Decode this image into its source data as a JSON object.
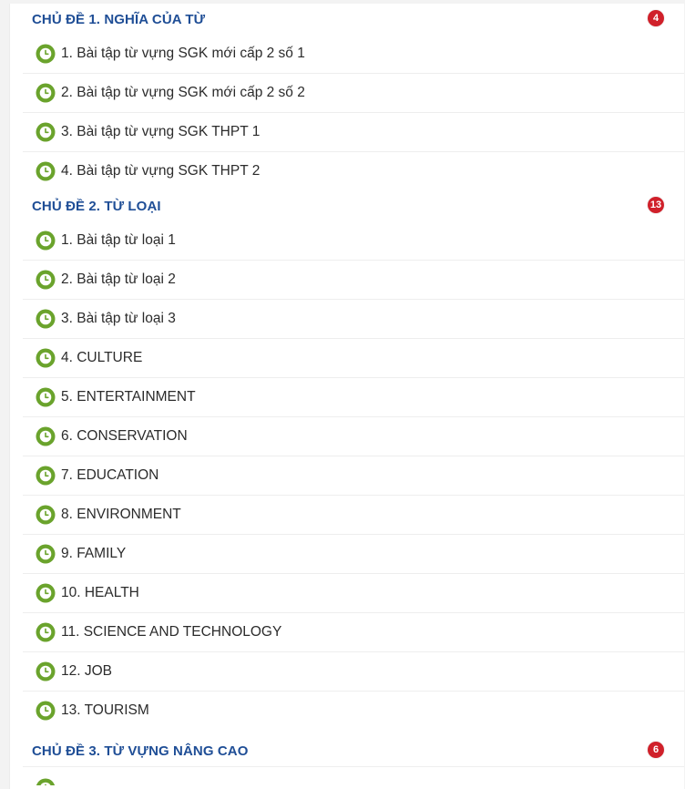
{
  "colors": {
    "section_title": "#1f4e96",
    "badge_red": "#d0202a",
    "clock_green": "#6aa32c",
    "text": "#2b2b2b"
  },
  "sections": [
    {
      "title": "CHỦ ĐỀ 1. NGHĨA CỦA TỪ",
      "count": "4",
      "lessons": [
        "1. Bài tập từ vựng SGK mới cấp 2 số 1",
        "2. Bài tập từ vựng SGK mới cấp 2 số 2",
        "3. Bài tập từ vựng SGK THPT 1",
        "4. Bài tập từ vựng SGK THPT 2"
      ]
    },
    {
      "title": "CHỦ ĐỀ 2. TỪ LOẠI",
      "count": "13",
      "lessons": [
        "1. Bài tập từ loại 1",
        "2. Bài tập từ loại 2",
        "3. Bài tập từ loại 3",
        "4. CULTURE",
        "5. ENTERTAINMENT",
        "6. CONSERVATION",
        "7. EDUCATION",
        "8. ENVIRONMENT",
        "9. FAMILY",
        "10. HEALTH",
        "11. SCIENCE AND TECHNOLOGY",
        "12. JOB",
        "13. TOURISM"
      ]
    },
    {
      "title": "CHỦ ĐỀ 3. TỪ VỰNG NÂNG CAO",
      "count": "6",
      "lessons": []
    }
  ],
  "icons": {
    "lesson_icon": "clock-icon"
  }
}
